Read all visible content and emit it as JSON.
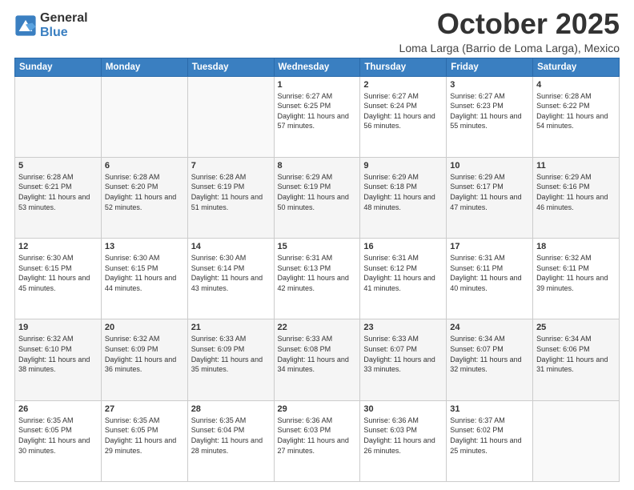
{
  "header": {
    "logo_general": "General",
    "logo_blue": "Blue",
    "month": "October 2025",
    "location": "Loma Larga (Barrio de Loma Larga), Mexico"
  },
  "days_of_week": [
    "Sunday",
    "Monday",
    "Tuesday",
    "Wednesday",
    "Thursday",
    "Friday",
    "Saturday"
  ],
  "weeks": [
    [
      {
        "day": "",
        "info": ""
      },
      {
        "day": "",
        "info": ""
      },
      {
        "day": "",
        "info": ""
      },
      {
        "day": "1",
        "info": "Sunrise: 6:27 AM\nSunset: 6:25 PM\nDaylight: 11 hours and 57 minutes."
      },
      {
        "day": "2",
        "info": "Sunrise: 6:27 AM\nSunset: 6:24 PM\nDaylight: 11 hours and 56 minutes."
      },
      {
        "day": "3",
        "info": "Sunrise: 6:27 AM\nSunset: 6:23 PM\nDaylight: 11 hours and 55 minutes."
      },
      {
        "day": "4",
        "info": "Sunrise: 6:28 AM\nSunset: 6:22 PM\nDaylight: 11 hours and 54 minutes."
      }
    ],
    [
      {
        "day": "5",
        "info": "Sunrise: 6:28 AM\nSunset: 6:21 PM\nDaylight: 11 hours and 53 minutes."
      },
      {
        "day": "6",
        "info": "Sunrise: 6:28 AM\nSunset: 6:20 PM\nDaylight: 11 hours and 52 minutes."
      },
      {
        "day": "7",
        "info": "Sunrise: 6:28 AM\nSunset: 6:19 PM\nDaylight: 11 hours and 51 minutes."
      },
      {
        "day": "8",
        "info": "Sunrise: 6:29 AM\nSunset: 6:19 PM\nDaylight: 11 hours and 50 minutes."
      },
      {
        "day": "9",
        "info": "Sunrise: 6:29 AM\nSunset: 6:18 PM\nDaylight: 11 hours and 48 minutes."
      },
      {
        "day": "10",
        "info": "Sunrise: 6:29 AM\nSunset: 6:17 PM\nDaylight: 11 hours and 47 minutes."
      },
      {
        "day": "11",
        "info": "Sunrise: 6:29 AM\nSunset: 6:16 PM\nDaylight: 11 hours and 46 minutes."
      }
    ],
    [
      {
        "day": "12",
        "info": "Sunrise: 6:30 AM\nSunset: 6:15 PM\nDaylight: 11 hours and 45 minutes."
      },
      {
        "day": "13",
        "info": "Sunrise: 6:30 AM\nSunset: 6:15 PM\nDaylight: 11 hours and 44 minutes."
      },
      {
        "day": "14",
        "info": "Sunrise: 6:30 AM\nSunset: 6:14 PM\nDaylight: 11 hours and 43 minutes."
      },
      {
        "day": "15",
        "info": "Sunrise: 6:31 AM\nSunset: 6:13 PM\nDaylight: 11 hours and 42 minutes."
      },
      {
        "day": "16",
        "info": "Sunrise: 6:31 AM\nSunset: 6:12 PM\nDaylight: 11 hours and 41 minutes."
      },
      {
        "day": "17",
        "info": "Sunrise: 6:31 AM\nSunset: 6:11 PM\nDaylight: 11 hours and 40 minutes."
      },
      {
        "day": "18",
        "info": "Sunrise: 6:32 AM\nSunset: 6:11 PM\nDaylight: 11 hours and 39 minutes."
      }
    ],
    [
      {
        "day": "19",
        "info": "Sunrise: 6:32 AM\nSunset: 6:10 PM\nDaylight: 11 hours and 38 minutes."
      },
      {
        "day": "20",
        "info": "Sunrise: 6:32 AM\nSunset: 6:09 PM\nDaylight: 11 hours and 36 minutes."
      },
      {
        "day": "21",
        "info": "Sunrise: 6:33 AM\nSunset: 6:09 PM\nDaylight: 11 hours and 35 minutes."
      },
      {
        "day": "22",
        "info": "Sunrise: 6:33 AM\nSunset: 6:08 PM\nDaylight: 11 hours and 34 minutes."
      },
      {
        "day": "23",
        "info": "Sunrise: 6:33 AM\nSunset: 6:07 PM\nDaylight: 11 hours and 33 minutes."
      },
      {
        "day": "24",
        "info": "Sunrise: 6:34 AM\nSunset: 6:07 PM\nDaylight: 11 hours and 32 minutes."
      },
      {
        "day": "25",
        "info": "Sunrise: 6:34 AM\nSunset: 6:06 PM\nDaylight: 11 hours and 31 minutes."
      }
    ],
    [
      {
        "day": "26",
        "info": "Sunrise: 6:35 AM\nSunset: 6:05 PM\nDaylight: 11 hours and 30 minutes."
      },
      {
        "day": "27",
        "info": "Sunrise: 6:35 AM\nSunset: 6:05 PM\nDaylight: 11 hours and 29 minutes."
      },
      {
        "day": "28",
        "info": "Sunrise: 6:35 AM\nSunset: 6:04 PM\nDaylight: 11 hours and 28 minutes."
      },
      {
        "day": "29",
        "info": "Sunrise: 6:36 AM\nSunset: 6:03 PM\nDaylight: 11 hours and 27 minutes."
      },
      {
        "day": "30",
        "info": "Sunrise: 6:36 AM\nSunset: 6:03 PM\nDaylight: 11 hours and 26 minutes."
      },
      {
        "day": "31",
        "info": "Sunrise: 6:37 AM\nSunset: 6:02 PM\nDaylight: 11 hours and 25 minutes."
      },
      {
        "day": "",
        "info": ""
      }
    ]
  ]
}
